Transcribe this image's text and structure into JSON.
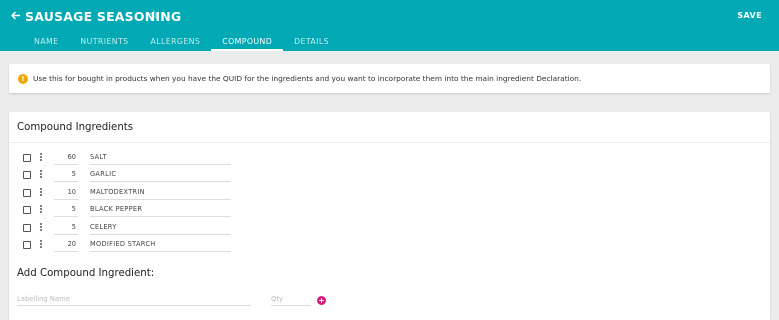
{
  "header": {
    "back_icon": "arrow-left-icon",
    "title": "SAUSAGE SEASONING",
    "star_icon": "star-outline-icon",
    "save_label": "SAVE",
    "background_color": "#00a9b3"
  },
  "tabs": [
    {
      "label": "NAME",
      "active": false
    },
    {
      "label": "NUTRIENTS",
      "active": false
    },
    {
      "label": "ALLERGENS",
      "active": false
    },
    {
      "label": "COMPOUND",
      "active": true
    },
    {
      "label": "DETAILS",
      "active": false
    }
  ],
  "info": {
    "icon": "info-warning-icon",
    "text": "Use this for bought in products when you have the QUID for the ingredients and you want to incorporate them into the main ingredient Declaration."
  },
  "compound": {
    "title": "Compound Ingredients",
    "ingredients": [
      {
        "qty": "60",
        "name": "SALT"
      },
      {
        "qty": "5",
        "name": "GARLIC"
      },
      {
        "qty": "10",
        "name": "MALTODEXTRIN"
      },
      {
        "qty": "5",
        "name": "BLACK PEPPER"
      },
      {
        "qty": "5",
        "name": "CELERY"
      },
      {
        "qty": "20",
        "name": "MODIFIED STARCH"
      }
    ]
  },
  "add": {
    "title": "Add Compound Ingredient:",
    "label_placeholder": "Labelling Name",
    "label_value": "",
    "qty_placeholder": "Qty",
    "qty_value": "",
    "add_icon": "plus-circle-icon",
    "accent_color": "#d81b7a"
  }
}
